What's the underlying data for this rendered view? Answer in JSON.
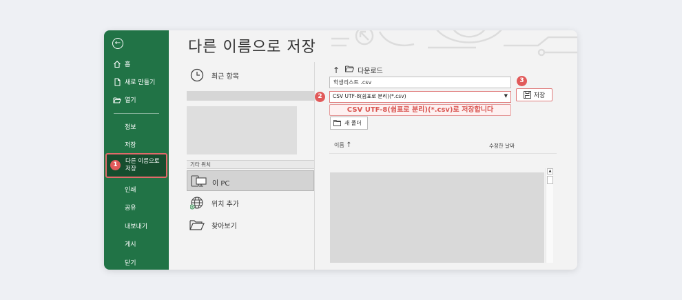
{
  "page_title": "다른 이름으로 저장",
  "sidebar": {
    "home": "홈",
    "new": "새로 만들기",
    "open": "열기",
    "info": "정보",
    "save": "저장",
    "save_as_line1": "다른 이름으로",
    "save_as_line2": "저장",
    "print": "인쇄",
    "share": "공유",
    "export": "내보내기",
    "publish": "게시",
    "close": "닫기",
    "accent_color": "#217346"
  },
  "locations": {
    "recent": "최근 항목",
    "other_header": "기타 위치",
    "this_pc": "이 PC",
    "add_place": "위치 추가",
    "browse": "찾아보기"
  },
  "file_panel": {
    "folder": "다운로드",
    "filename": "학생리스트 .csv",
    "filetype": "CSV UTF-8(쉼표로 분리)(*.csv)",
    "save_button": "저장",
    "hint": "CSV UTF-8(쉼표로 분리)(*.csv)로 저장합니다",
    "new_folder": "새 폴더",
    "col_name": "이름",
    "col_date": "수정한 날짜"
  },
  "badges": {
    "b1": "1",
    "b2": "2",
    "b3": "3",
    "badge_color": "#e15a5a"
  }
}
